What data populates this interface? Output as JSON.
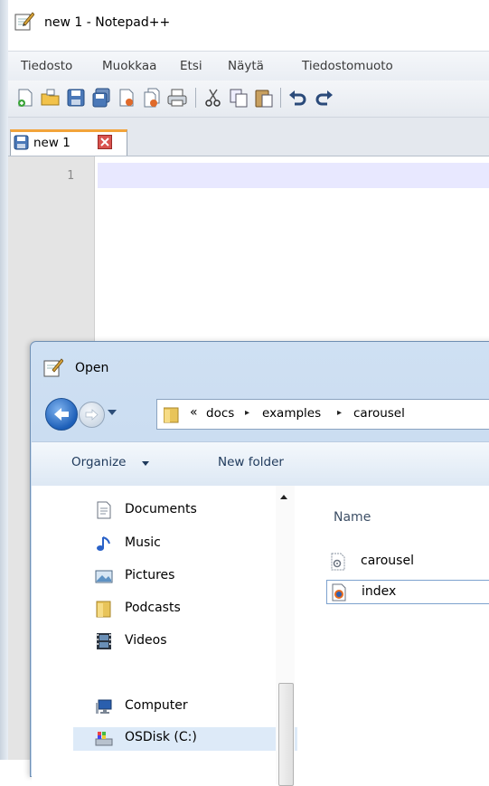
{
  "window": {
    "title": "new 1 - Notepad++"
  },
  "menu": [
    "Tiedosto",
    "Muokkaa",
    "Etsi",
    "Näytä",
    "Tiedostomuoto"
  ],
  "toolbar": {
    "buttons": [
      "new-file-icon",
      "open-file-icon",
      "save-icon",
      "save-all-icon",
      "close-icon",
      "close-all-icon",
      "print-icon",
      "cut-icon",
      "copy-icon",
      "paste-icon",
      "undo-icon",
      "redo-icon"
    ]
  },
  "tab": {
    "label": "new 1"
  },
  "editor": {
    "line_number": "1"
  },
  "dialog": {
    "title": "Open",
    "breadcrumb": {
      "overflow": "«",
      "parts": [
        "docs",
        "examples",
        "carousel"
      ],
      "separator": "▸"
    },
    "commands": {
      "organize": "Organize",
      "new_folder": "New folder"
    },
    "nav_items": [
      "Documents",
      "Music",
      "Pictures",
      "Podcasts",
      "Videos",
      "Computer",
      "OSDisk (C:)"
    ],
    "column_header": "Name",
    "files": [
      "carousel",
      "index"
    ]
  },
  "colors": {
    "tab_accent": "#f2a43a",
    "current_line": "#e8e8ff",
    "dialog_frame": "#bcd2ea",
    "selection": "#ddeaf8"
  }
}
